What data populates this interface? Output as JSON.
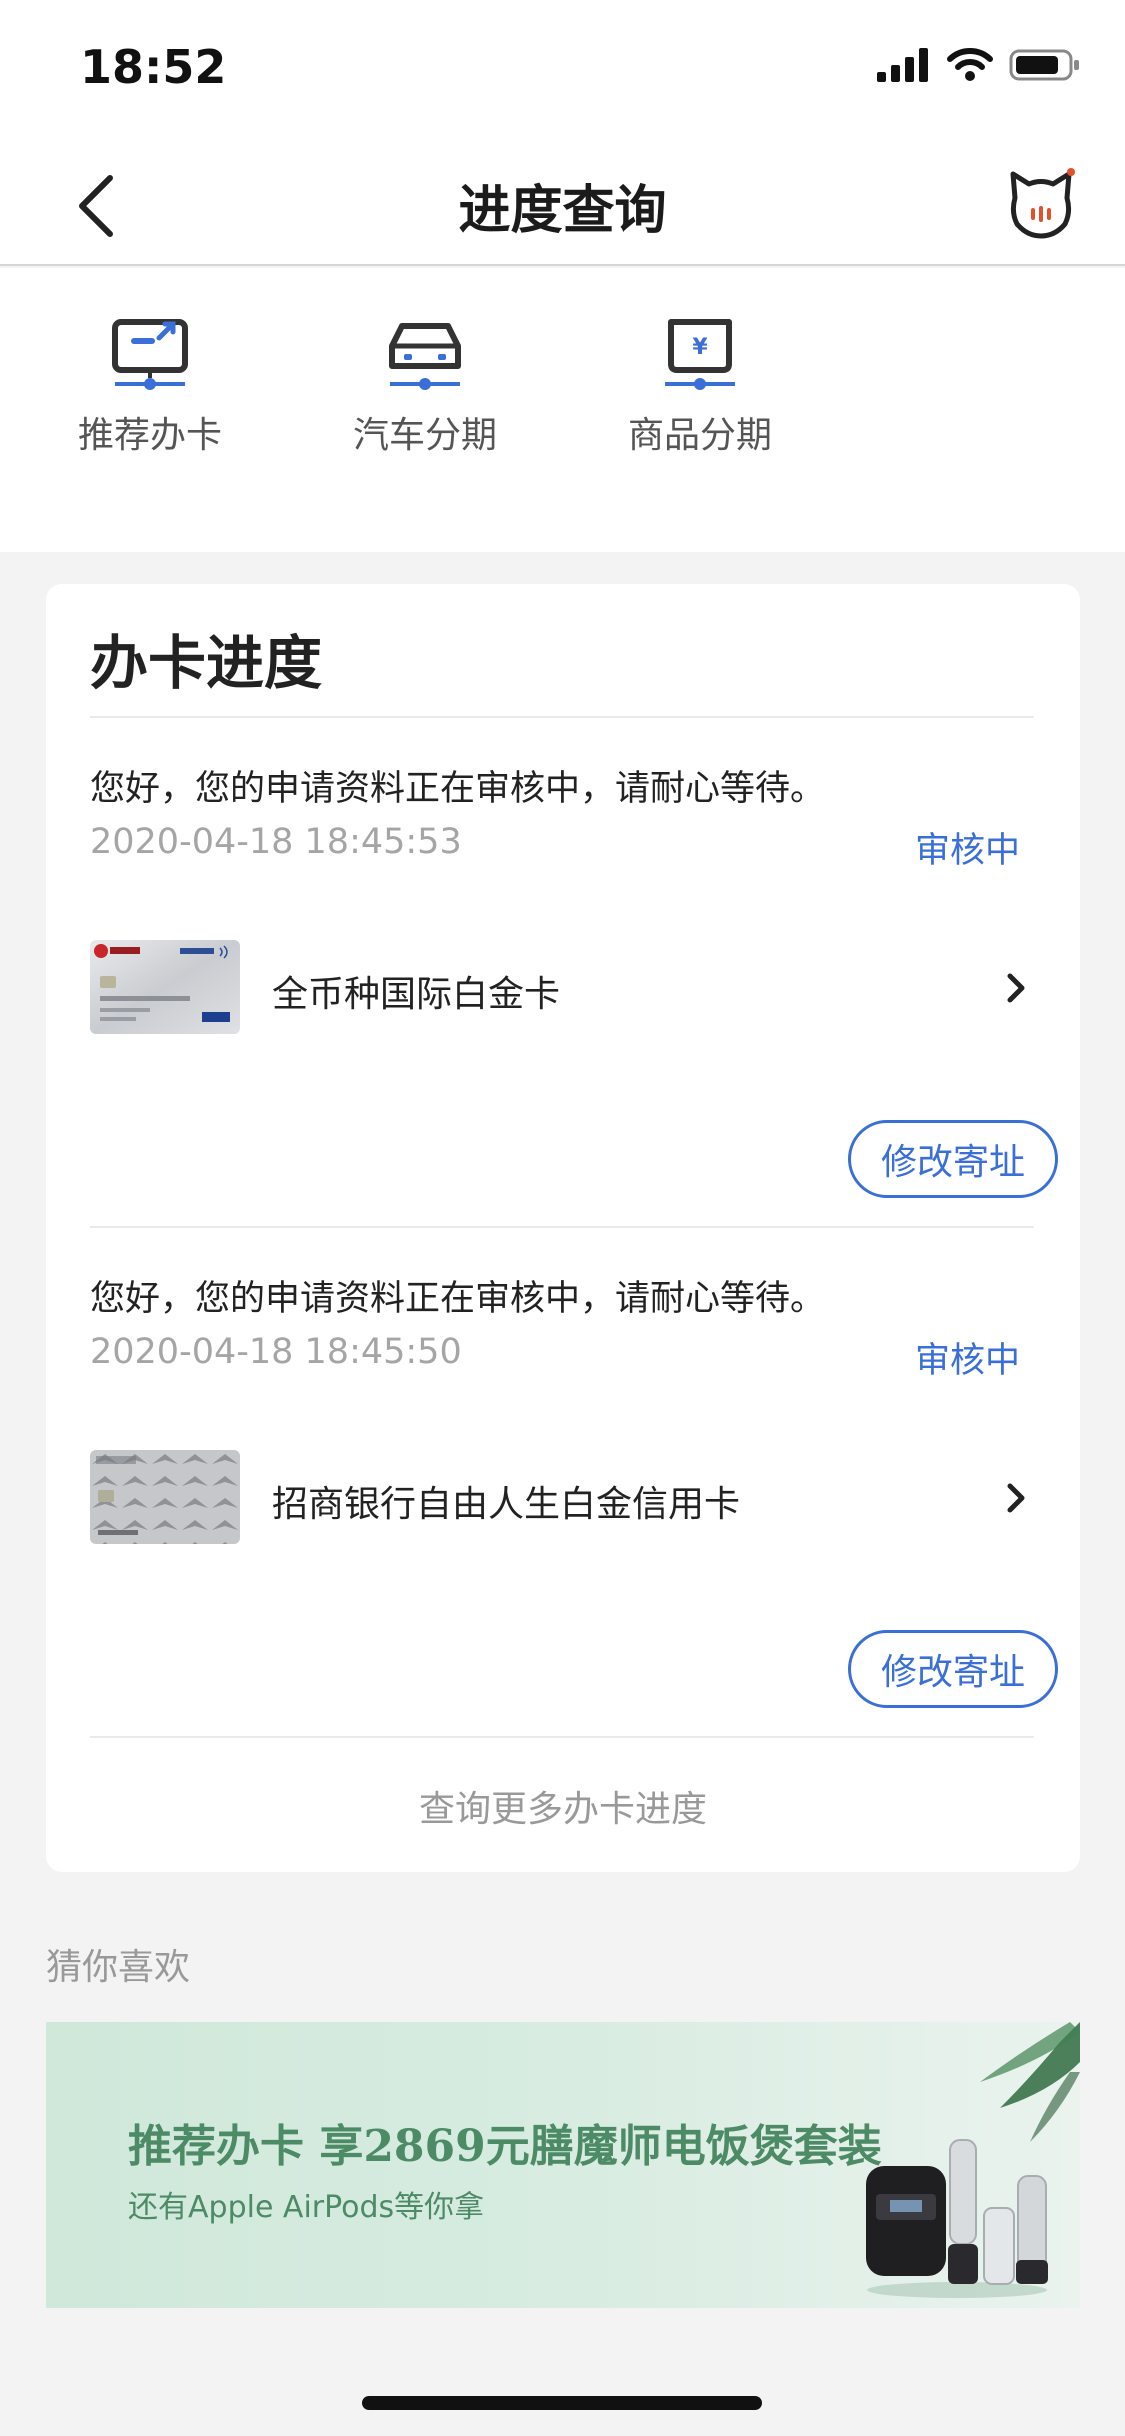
{
  "status_bar": {
    "time": "18:52"
  },
  "nav": {
    "title": "进度查询"
  },
  "quick_actions": [
    {
      "label": "推荐办卡",
      "icon": "recommend-card-icon"
    },
    {
      "label": "汽车分期",
      "icon": "car-installment-icon"
    },
    {
      "label": "商品分期",
      "icon": "goods-installment-icon"
    }
  ],
  "panel": {
    "title": "办卡进度",
    "applications": [
      {
        "message": "您好，您的申请资料正在审核中，请耐心等待。",
        "time": "2020-04-18 18:45:53",
        "status": "审核中",
        "card_name": "全币种国际白金卡",
        "button": "修改寄址"
      },
      {
        "message": "您好，您的申请资料正在审核中，请耐心等待。",
        "time": "2020-04-18 18:45:50",
        "status": "审核中",
        "card_name": "招商银行自由人生白金信用卡",
        "button": "修改寄址"
      }
    ],
    "more_link": "查询更多办卡进度"
  },
  "recommend": {
    "title": "猜你喜欢",
    "banner_title": "推荐办卡 享2869元膳魔师电饭煲套装",
    "banner_subtitle": "还有Apple AirPods等你拿"
  },
  "colors": {
    "accent": "#3a6fd8",
    "banner_text": "#4d8a66",
    "background": "#f3f3f3"
  }
}
